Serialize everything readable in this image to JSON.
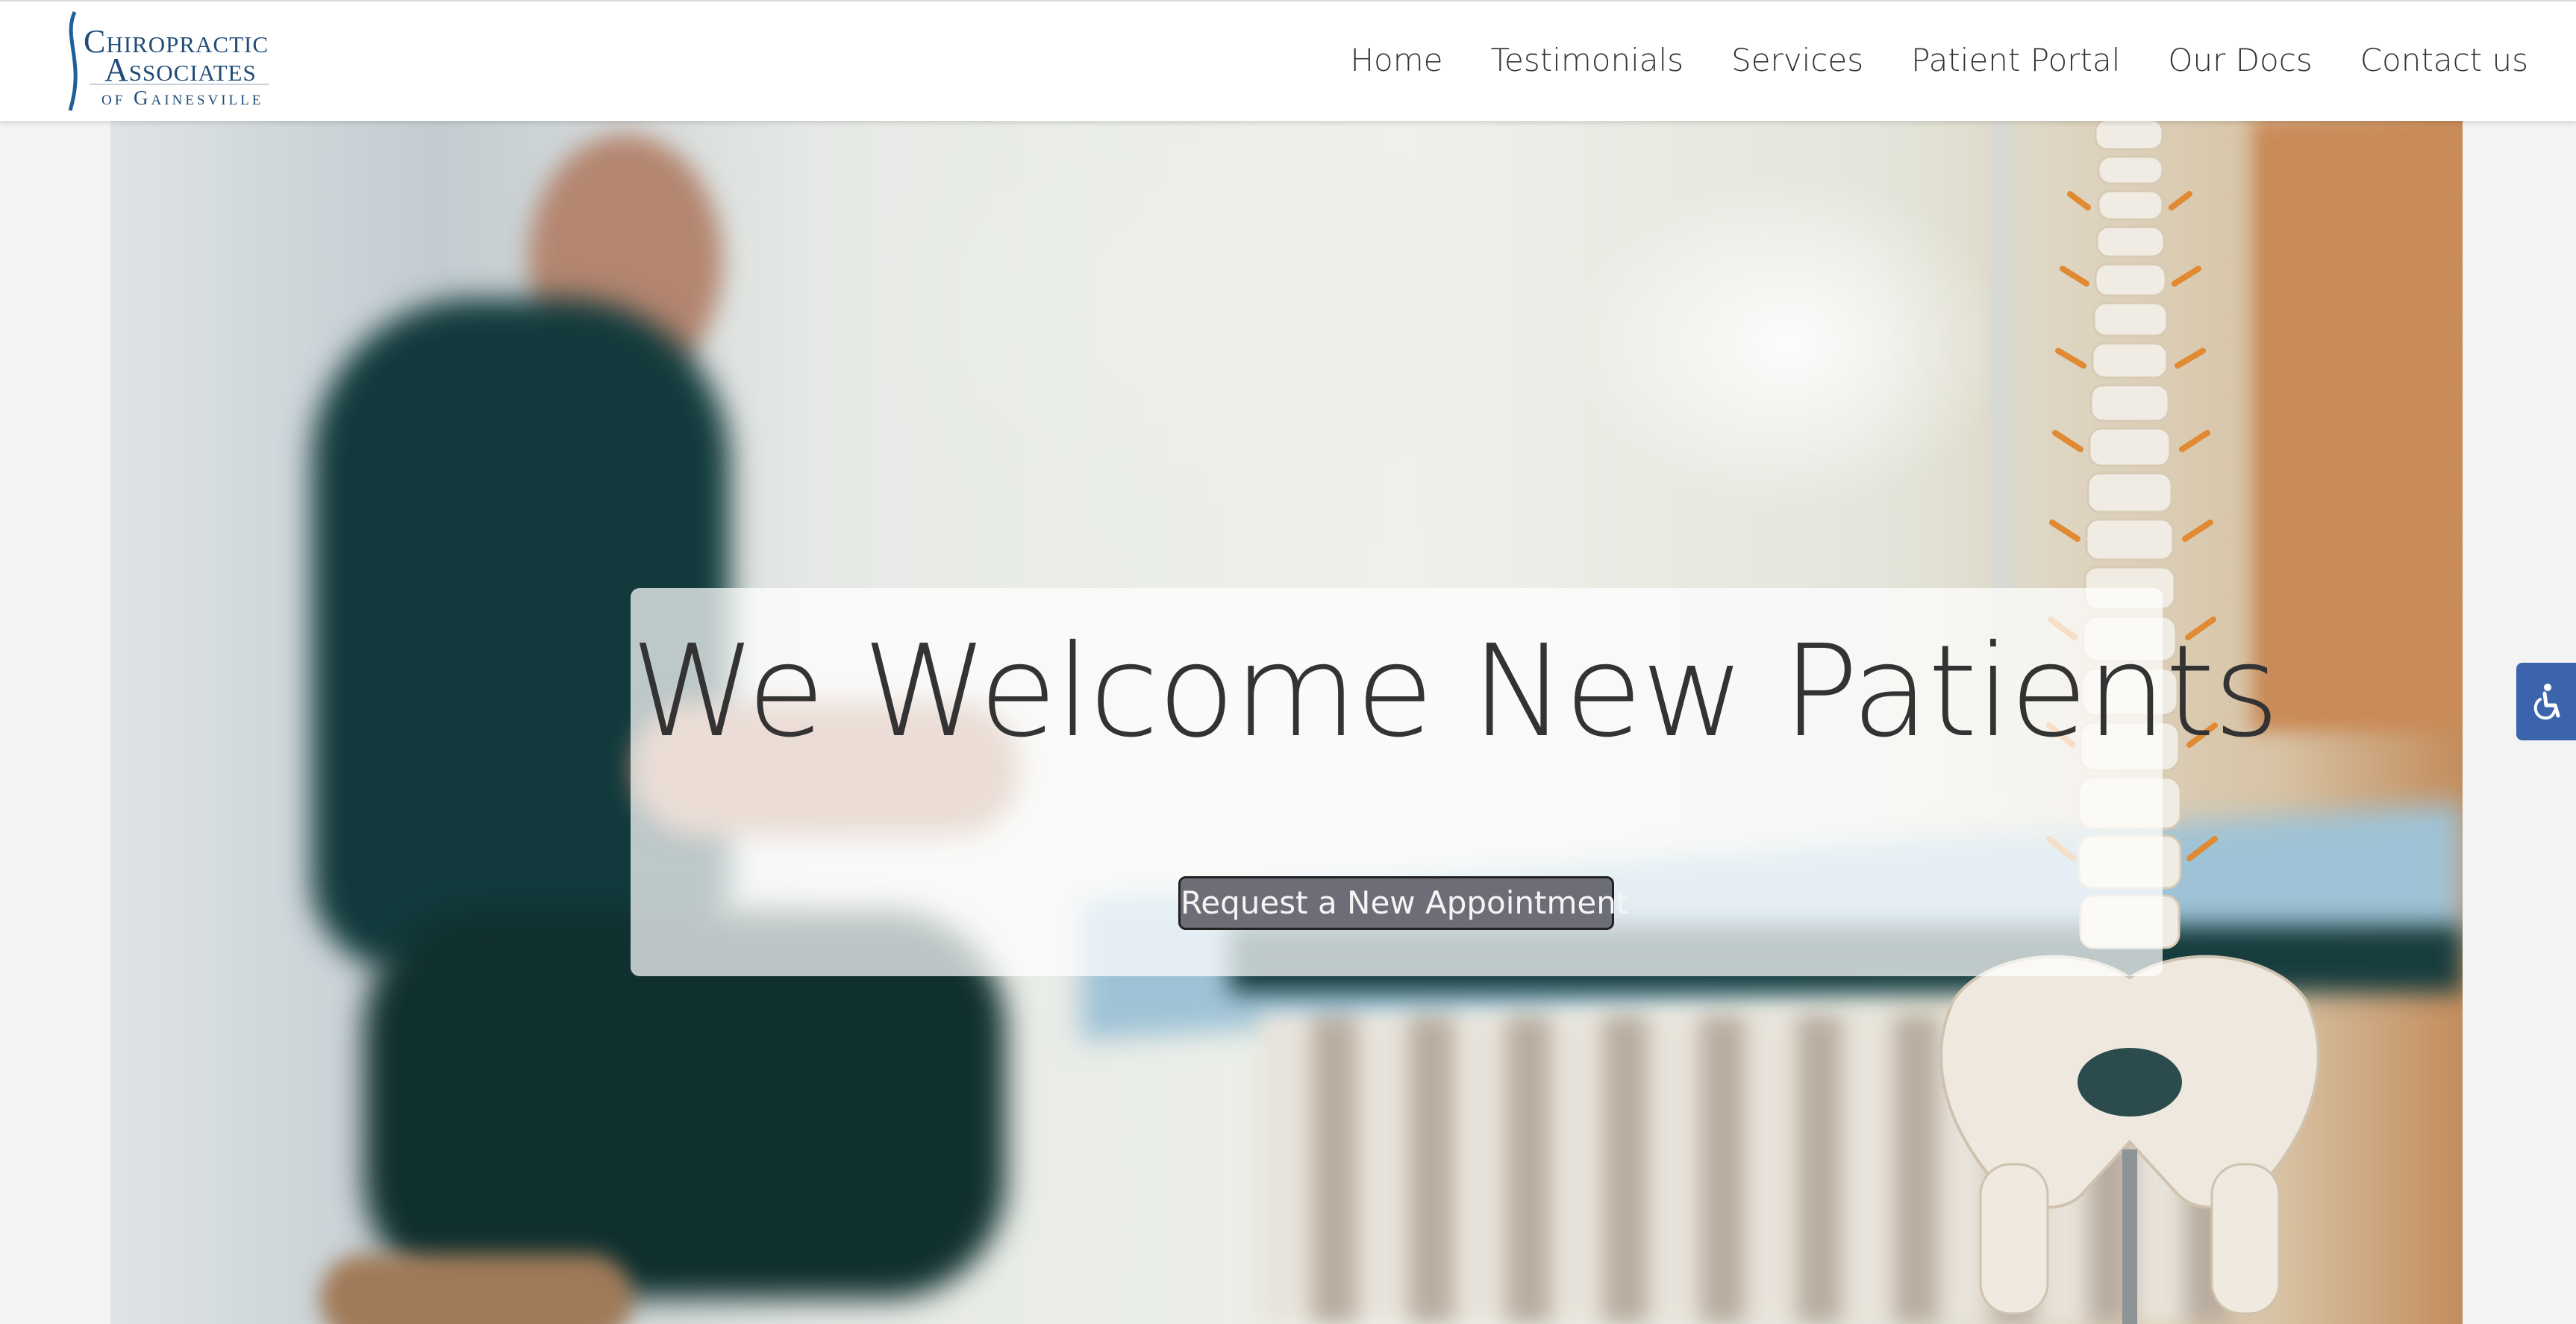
{
  "brand": {
    "line1": "Chiropractic",
    "line2": "Associates",
    "line3": "of Gainesville",
    "color": "#1f4c78"
  },
  "nav": {
    "items": [
      {
        "label": "Home"
      },
      {
        "label": "Testimonials"
      },
      {
        "label": "Services"
      },
      {
        "label": "Patient Portal"
      },
      {
        "label": "Our Docs"
      },
      {
        "label": "Contact us"
      }
    ]
  },
  "hero": {
    "heading": "We Welcome New Patients",
    "cta_label": "Request a New Appointment"
  },
  "accessibility": {
    "icon": "accessibility-icon",
    "color": "#3c64ad"
  }
}
